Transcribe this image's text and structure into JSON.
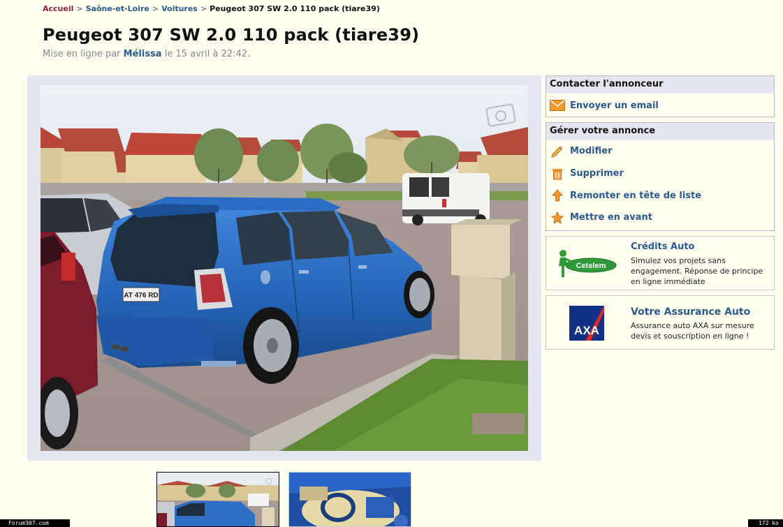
{
  "breadcrumb": {
    "home": "Accueil",
    "region": "Saône-et-Loire",
    "category": "Voitures",
    "current": "Peugeot 307 SW 2.0 110 pack (tiare39)",
    "separator": ">"
  },
  "listing": {
    "title": "Peugeot 307 SW 2.0 110 pack (tiare39)",
    "posted_prefix": "Mise en ligne par",
    "author": "Mélissa",
    "posted_suffix": "le 15 avril à 22:42.",
    "plate_text": "AT 476 RD"
  },
  "contact": {
    "header": "Contacter l'annonceur",
    "email_label": "Envoyer un email",
    "email_icon": "envelope-icon"
  },
  "manage": {
    "header": "Gérer votre annonce",
    "items": [
      {
        "label": "Modifier",
        "icon": "pencil-icon"
      },
      {
        "label": "Supprimer",
        "icon": "trash-icon"
      },
      {
        "label": "Remonter en tête de liste",
        "icon": "arrow-up-icon"
      },
      {
        "label": "Mettre en avant",
        "icon": "star-icon"
      }
    ]
  },
  "promos": [
    {
      "title": "Crédits Auto",
      "text": "Simulez vos projets sans engagement. Réponse de principe en ligne immédiate",
      "logo_text": "Cetelem"
    },
    {
      "title": "Votre Assurance Auto",
      "text": "Assurance auto AXA sur mesure devis et souscription en ligne !",
      "logo_text": "AXA"
    }
  ],
  "status": {
    "left": "Forum307.com",
    "right": "172 ko"
  },
  "colors": {
    "background": "#fffff0",
    "link": "#2a5a92",
    "home_link": "#8b2040",
    "box_header": "#e6e6f2",
    "car_blue": "#2e6fc4"
  }
}
